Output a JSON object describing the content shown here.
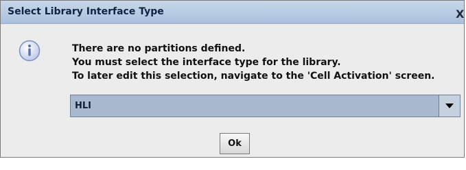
{
  "window": {
    "title": "Select Library Interface Type",
    "close_label": "X"
  },
  "message": {
    "lines": [
      "There are no partitions defined.",
      "You must select the interface type for the library.",
      "To later edit this selection, navigate to the 'Cell Activation' screen."
    ]
  },
  "interface_select": {
    "selected": "HLI"
  },
  "buttons": {
    "ok": "Ok"
  },
  "icons": {
    "info": "info-icon",
    "dropdown": "chevron-down-icon",
    "close": "close-icon"
  },
  "colors": {
    "titlebar": "#b8cbe3",
    "combo_bg": "#a8b8cf",
    "dialog_bg": "#ececec"
  }
}
